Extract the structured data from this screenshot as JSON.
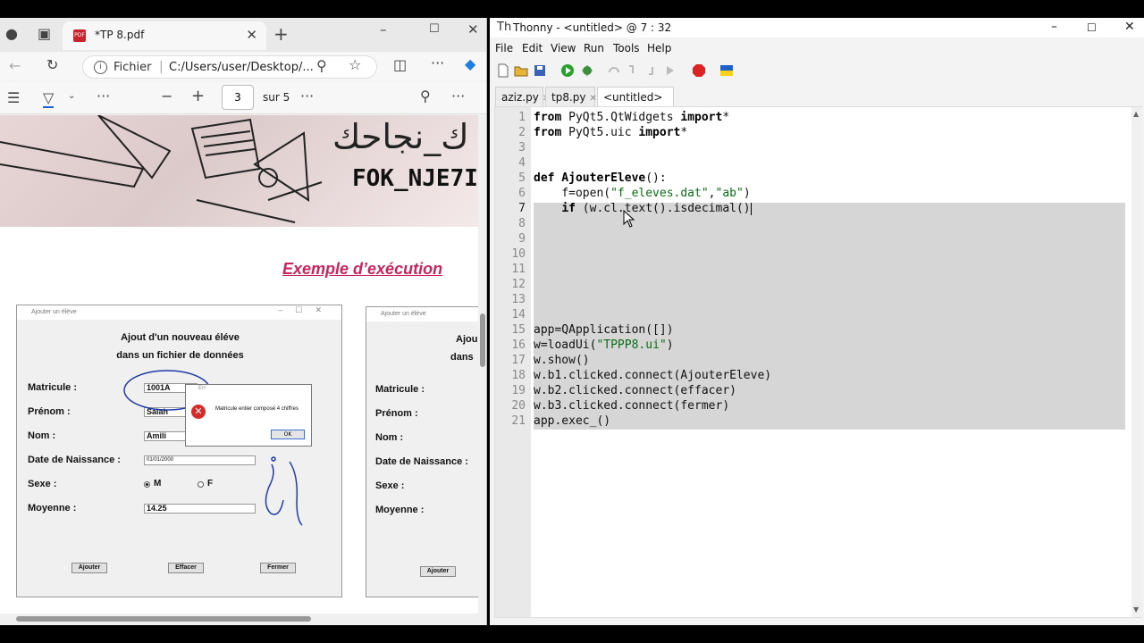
{
  "edge": {
    "tab_title": "*TP 8.pdf",
    "address_scheme": "Fichier",
    "address_path": "C:/Users/user/Desktop/...",
    "page_current": "3",
    "page_total": "sur 5",
    "banner_arabic": "ك_نجاحك",
    "banner_latin": "FOK_NJE7IK",
    "exemple_heading": "Exemple d’exécution",
    "app_window_title": "Ajouter un élève",
    "app_heading_line1": "Ajout d'un nouveau éléve",
    "app_heading_line2": "dans un fichier de données",
    "labels": {
      "matricule": "Matricule :",
      "prenom": "Prénom :",
      "nom": "Nom :",
      "date": "Date de Naissance :",
      "sexe": "Sexe :",
      "moyenne": "Moyenne :"
    },
    "values": {
      "matricule": "1001A",
      "prenom": "Salah",
      "nom": "Amili",
      "date": "01/01/2000",
      "sexe_m": "M",
      "sexe_f": "F",
      "moyenne": "14.25"
    },
    "buttons": {
      "ajouter": "Ajouter",
      "effacer": "Effacer",
      "fermer": "Fermer"
    },
    "dialog_title": "Err",
    "dialog_message": "Matricule entier composé 4 chiffres",
    "dialog_ok": "OK",
    "app2_heading_line1": "Ajou",
    "app2_heading_line2": "dans"
  },
  "thonny": {
    "title": "Thonny  -  <untitled>  @  7 : 32",
    "menus": [
      "File",
      "Edit",
      "View",
      "Run",
      "Tools",
      "Help"
    ],
    "tabs": [
      "aziz.py",
      "tp8.py",
      "<untitled> *"
    ],
    "line_numbers": [
      "1",
      "2",
      "3",
      "4",
      "5",
      "6",
      "7",
      "8",
      "9",
      "10",
      "11",
      "12",
      "13",
      "14",
      "15",
      "16",
      "17",
      "18",
      "19",
      "20",
      "21"
    ],
    "code": {
      "l1a": "from",
      "l1b": " PyQt5.QtWidgets ",
      "l1c": "import",
      "l1d": "*",
      "l2a": "from",
      "l2b": " PyQt5.uic ",
      "l2c": "import",
      "l2d": "*",
      "l5a": "def",
      "l5b": " AjouterEleve",
      "l5c": "():",
      "l6a": "    f=open(",
      "l6b": "\"f_eleves.dat\"",
      "l6c": ",",
      "l6d": "\"ab\"",
      "l6e": ")",
      "l7a": "    ",
      "l7b": "if",
      "l7c": " (w.cl.text().isdecimal()",
      "l15": "app=QApplication([])",
      "l16a": "w=loadUi(",
      "l16b": "\"TPPP8.ui\"",
      "l16c": ")",
      "l17": "w.show()",
      "l18": "w.b1.clicked.connect(AjouterEleve)",
      "l19": "w.b2.clicked.connect(effacer)",
      "l20": "w.b3.clicked.connect(fermer)",
      "l21": "app.exec_()"
    }
  }
}
